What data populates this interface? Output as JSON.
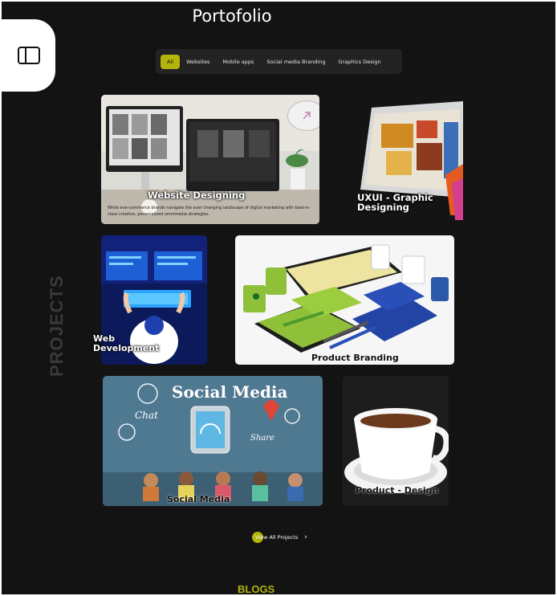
{
  "page": {
    "title": "Portofolio"
  },
  "filters": [
    {
      "label": "All",
      "active": true
    },
    {
      "label": "Websites",
      "active": false
    },
    {
      "label": "Mobile apps",
      "active": false
    },
    {
      "label": "Social media Branding",
      "active": false
    },
    {
      "label": "Graphics Design",
      "active": false
    }
  ],
  "projects": {
    "section_label": "PROJECTS",
    "cards": [
      {
        "title": "Website Designing",
        "description": "While eve-commerce brands navigate the ever changing landscape of digital marketing with best-in-class creative, personalized omnimedia strategies."
      },
      {
        "title": "UXUI - Graphic Designing"
      },
      {
        "title": "Web Development"
      },
      {
        "title": "Product Branding"
      },
      {
        "title": "Social Media"
      },
      {
        "title": "Product - Design"
      }
    ]
  },
  "social_media_banner": {
    "heading": "Social Media",
    "chat": "Chat",
    "share": "Share"
  },
  "cta": {
    "view_all": "View All Projects",
    "chevron": "›"
  },
  "blogs": {
    "label": "BLOGS"
  },
  "icons": {
    "sidebar": "sidebar-panel-icon",
    "arrow": "arrow-up-right-icon",
    "chevron": "chevron-right-icon"
  },
  "colors": {
    "accent": "#b3b40c",
    "background": "#131313"
  }
}
